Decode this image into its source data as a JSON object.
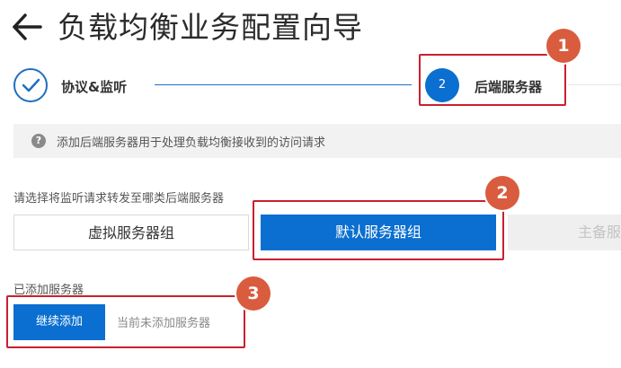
{
  "header": {
    "back_icon": "arrow-left-icon",
    "title": "负载均衡业务配置向导"
  },
  "steps": [
    {
      "label": "协议&监听",
      "state": "completed",
      "icon": "check-icon"
    },
    {
      "number": "2",
      "label": "后端服务器",
      "state": "active"
    }
  ],
  "tip": {
    "icon": "question-circle-icon",
    "text": "添加后端服务器用于处理负载均衡接收到的访问请求"
  },
  "server_type": {
    "label": "请选择将监听请求转发至哪类后端服务器",
    "options": [
      {
        "label": "虚拟服务器组",
        "selected": false
      },
      {
        "label": "默认服务器组",
        "selected": true
      },
      {
        "label": "主备服",
        "selected": false,
        "disabled": true
      }
    ]
  },
  "added_servers": {
    "label": "已添加服务器",
    "continue_label": "继续添加",
    "empty_text": "当前未添加服务器"
  },
  "callouts": [
    "1",
    "2",
    "3"
  ],
  "colors": {
    "primary": "#0a6fd0",
    "highlight_border": "#c8202f",
    "callout_badge": "#d95c3e"
  }
}
